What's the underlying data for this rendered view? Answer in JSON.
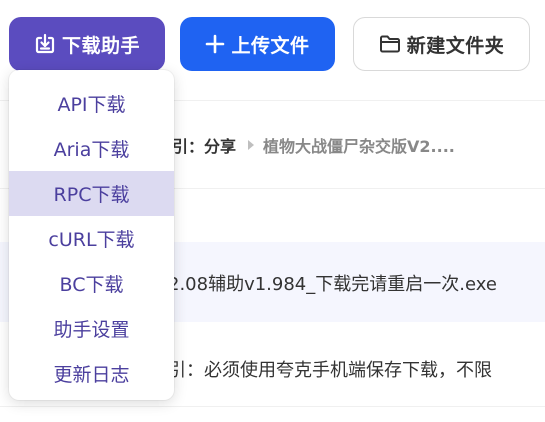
{
  "toolbar": {
    "download_label": "下载助手",
    "upload_label": "上传文件",
    "new_folder_label": "新建文件夹"
  },
  "breadcrumb": {
    "partial_prefix": "引：",
    "share": "分享",
    "current": "植物大战僵尸杂交版V2...."
  },
  "file_rows": [
    {
      "partial_name": "2.08辅助v1.984_下载完请重启一次.exe"
    },
    {
      "partial_name": "引：必须使用夸克手机端保存下载，不限"
    }
  ],
  "download_menu": {
    "items": [
      {
        "label": "API下载"
      },
      {
        "label": "Aria下载"
      },
      {
        "label": "RPC下载"
      },
      {
        "label": "cURL下载"
      },
      {
        "label": "BC下载"
      },
      {
        "label": "助手设置"
      },
      {
        "label": "更新日志"
      }
    ],
    "hovered_item": "RPC下载"
  },
  "colors": {
    "download_button": "#5b4cbf",
    "upload_button": "#1f63f2",
    "menu_text": "#4b3f9e",
    "menu_hover": "#dcdaf1",
    "row_highlight": "#f5f6fe"
  }
}
